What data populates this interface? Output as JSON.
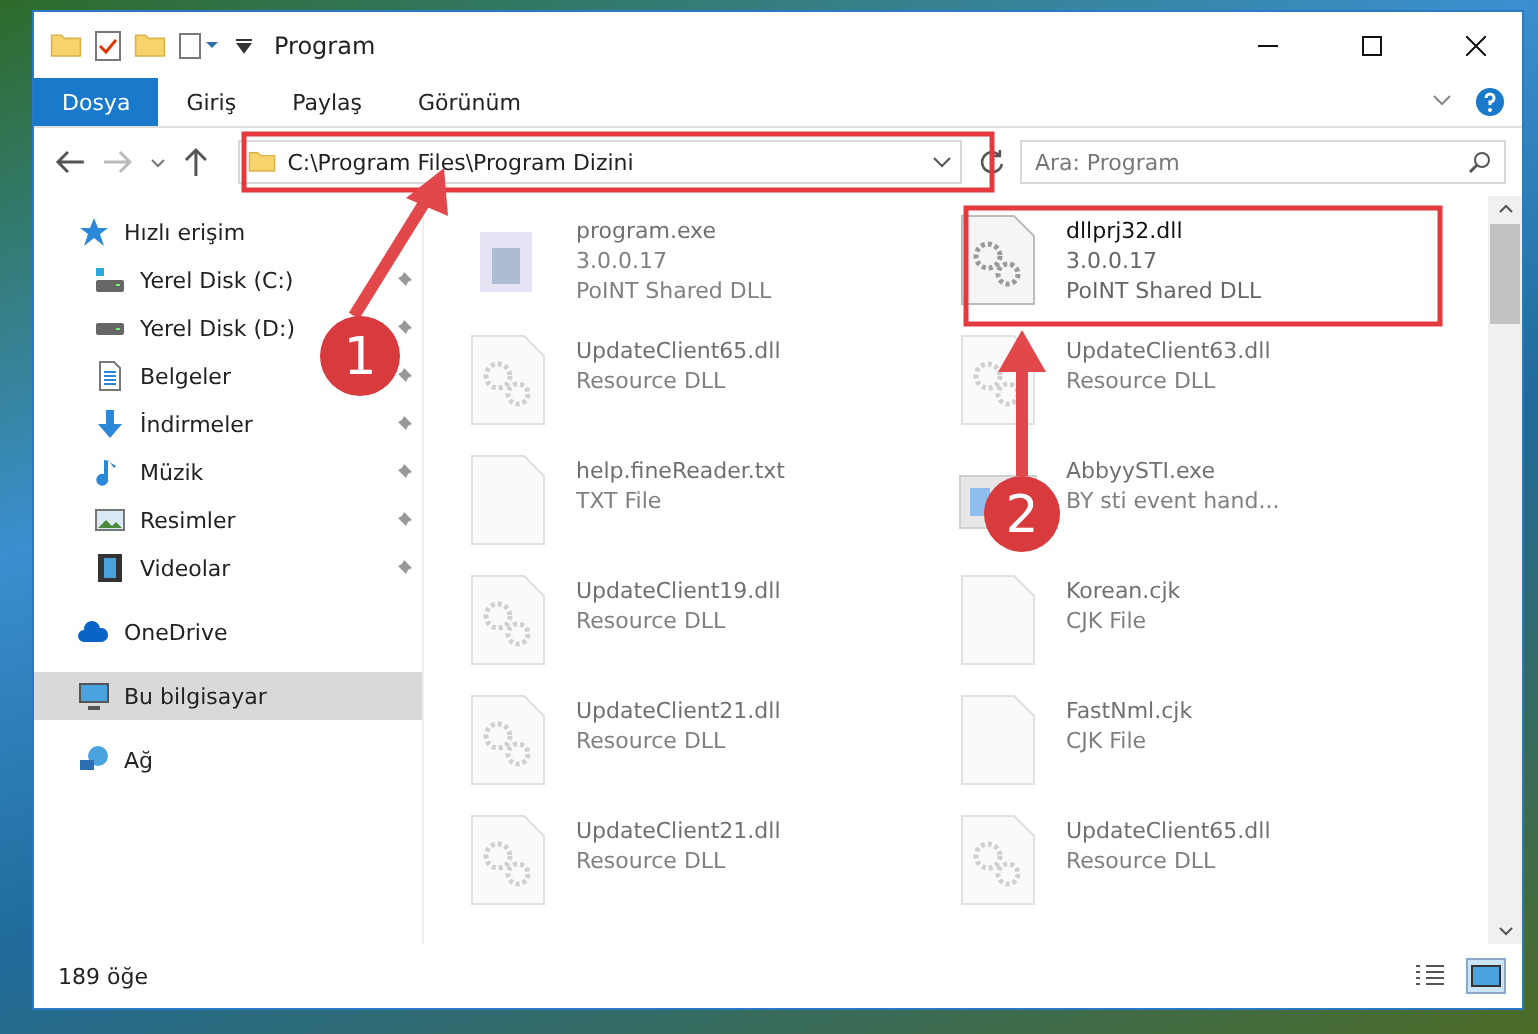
{
  "window": {
    "title": "Program"
  },
  "ribbon_tabs": [
    {
      "label": "Dosya",
      "kind": "file"
    },
    {
      "label": "Giriş",
      "kind": "tab"
    },
    {
      "label": "Paylaş",
      "kind": "tab"
    },
    {
      "label": "Görünüm",
      "kind": "tab"
    }
  ],
  "address": {
    "path": "C:\\Program Files\\Program Dizini"
  },
  "search": {
    "placeholder": "Ara: Program"
  },
  "sidebar": {
    "items": [
      {
        "label": "Hızlı erişim",
        "selected": false,
        "children": [
          {
            "label": "Yerel Disk (C:)",
            "pinned": true
          },
          {
            "label": "Yerel Disk (D:)",
            "pinned": true
          },
          {
            "label": "Belgeler",
            "pinned": true
          },
          {
            "label": "İndirmeler",
            "pinned": true
          },
          {
            "label": "Müzik",
            "pinned": true
          },
          {
            "label": "Resimler",
            "pinned": true
          },
          {
            "label": "Videolar",
            "pinned": true
          }
        ]
      },
      {
        "label": "OneDrive",
        "selected": false
      },
      {
        "label": "Bu bilgisayar",
        "selected": true
      },
      {
        "label": "Ağ",
        "selected": false
      }
    ]
  },
  "files": [
    {
      "name": "program.exe",
      "lines": [
        "3.0.0.17",
        "PoINT Shared DLL"
      ],
      "kind": "exe",
      "faded": true
    },
    {
      "name": "dllprj32.dll",
      "lines": [
        "3.0.0.17",
        "PoINT Shared DLL"
      ],
      "kind": "dll",
      "faded": false
    },
    {
      "name": "UpdateClient65.dll",
      "lines": [
        "Resource DLL"
      ],
      "kind": "dll",
      "faded": true
    },
    {
      "name": "UpdateClient63.dll",
      "lines": [
        "Resource DLL"
      ],
      "kind": "dll",
      "faded": true
    },
    {
      "name": "help.fineReader.txt",
      "lines": [
        "TXT File"
      ],
      "kind": "txt",
      "faded": true
    },
    {
      "name": "AbbyySTI.exe",
      "lines": [
        "BY sti event hand..."
      ],
      "kind": "app",
      "faded": true
    },
    {
      "name": "UpdateClient19.dll",
      "lines": [
        "Resource DLL"
      ],
      "kind": "dll",
      "faded": true
    },
    {
      "name": "Korean.cjk",
      "lines": [
        "CJK File"
      ],
      "kind": "txt",
      "faded": true
    },
    {
      "name": "UpdateClient21.dll",
      "lines": [
        "Resource DLL"
      ],
      "kind": "dll",
      "faded": true
    },
    {
      "name": "FastNml.cjk",
      "lines": [
        "CJK File"
      ],
      "kind": "txt",
      "faded": true
    },
    {
      "name": "UpdateClient21.dll",
      "lines": [
        "Resource DLL"
      ],
      "kind": "dll",
      "faded": true
    },
    {
      "name": "UpdateClient65.dll",
      "lines": [
        "Resource DLL"
      ],
      "kind": "dll",
      "faded": true
    }
  ],
  "status_bar": {
    "count": "189 öğe",
    "views": [
      {
        "kind": "details",
        "selected": false
      },
      {
        "kind": "large-icons",
        "selected": true
      }
    ]
  },
  "annotations": [
    {
      "label": "1"
    },
    {
      "label": "2"
    }
  ]
}
